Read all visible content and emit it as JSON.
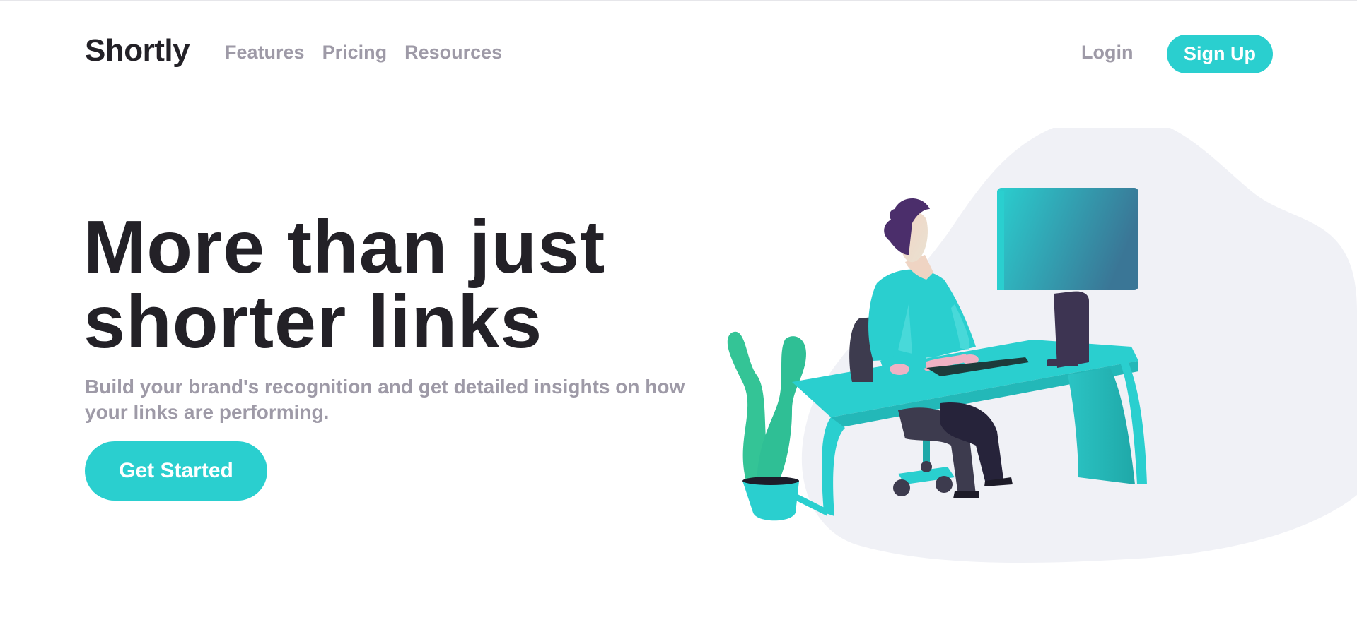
{
  "header": {
    "logo": "Shortly",
    "nav": [
      {
        "label": "Features"
      },
      {
        "label": "Pricing"
      },
      {
        "label": "Resources"
      }
    ],
    "login_label": "Login",
    "signup_label": "Sign Up"
  },
  "hero": {
    "title_line1": "More than just",
    "title_line2": "shorter links",
    "subtitle": "Build your brand's recognition and get detailed insights on how your links are performing.",
    "cta_label": "Get Started"
  },
  "illustration": {
    "icon": "person-working-at-desk-illustration"
  },
  "colors": {
    "accent": "#2acfcf",
    "dark_text": "#232127",
    "gray_text": "#9e9aa7",
    "blob_bg": "#f0f1f6"
  }
}
